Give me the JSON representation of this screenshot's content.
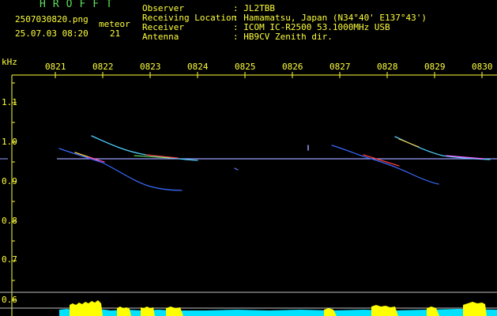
{
  "header": {
    "app_title": "HROFFT",
    "filename": "2507030820.png",
    "meteor_label": "meteor",
    "datetime": "25.07.03 08:20",
    "meteor_count": "21"
  },
  "info": [
    {
      "key": "Observer",
      "value": ": JL2TBB"
    },
    {
      "key": "Receiving Location",
      "value": ": Hamamatsu, Japan (N34°40' E137°43')"
    },
    {
      "key": "Receiver",
      "value": ": ICOM IC-R2500 53.1000MHz USB"
    },
    {
      "key": "Antenna",
      "value": ": HB9CV Zenith dir."
    }
  ],
  "axis": {
    "y_unit": "kHz",
    "x_ticks": [
      "0821",
      "0822",
      "0823",
      "0824",
      "0825",
      "0826",
      "0827",
      "0828",
      "0829",
      "0830"
    ],
    "y_ticks": [
      "1.1",
      "1.0",
      "0.9",
      "0.8",
      "0.7",
      "0.6"
    ]
  },
  "colors": {
    "label_text": "#8ef08e",
    "tick_text": "#ffff3c",
    "carrier": "#9aa0ff",
    "level_bar": "#ffff00",
    "noise_fill": "#00e0ff"
  }
}
